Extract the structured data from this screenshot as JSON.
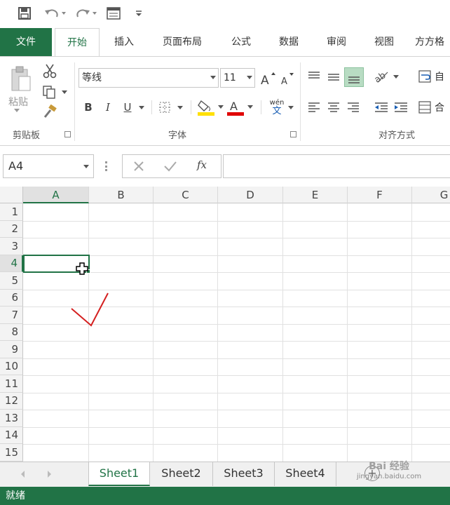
{
  "qat": {
    "save": "save-icon",
    "undo": "undo-icon",
    "redo": "redo-icon",
    "form": "form-icon",
    "customize": "customize-icon"
  },
  "tabs": {
    "file": "文件",
    "items": [
      "开始",
      "插入",
      "页面布局",
      "公式",
      "数据",
      "审阅",
      "视图",
      "方方格"
    ]
  },
  "ribbon": {
    "clipboard": {
      "paste": "粘贴",
      "label": "剪贴板"
    },
    "font": {
      "name": "等线",
      "size": "11",
      "bold": "B",
      "italic": "I",
      "underline": "U",
      "wen_top": "wén",
      "wen_bottom": "文",
      "label": "字体",
      "highlight_color": "#ffe000",
      "font_color": "#e00000"
    },
    "alignment": {
      "label": "对齐方式",
      "wrap": "自",
      "merge": "合"
    }
  },
  "formula_bar": {
    "name_box": "A4",
    "fx": "fx"
  },
  "grid": {
    "columns": [
      "A",
      "B",
      "C",
      "D",
      "E",
      "F",
      "G"
    ],
    "rows": [
      "1",
      "2",
      "3",
      "4",
      "5",
      "6",
      "7",
      "8",
      "9",
      "10",
      "11",
      "12",
      "13",
      "14",
      "15"
    ],
    "selected_cell": "A4"
  },
  "sheets": [
    "Sheet1",
    "Sheet2",
    "Sheet3",
    "Sheet4"
  ],
  "status": {
    "text": "就绪"
  },
  "watermark": {
    "text": "jingyan.baidu.com"
  },
  "colors": {
    "accent": "#217346",
    "check_mark": "#d42020"
  }
}
